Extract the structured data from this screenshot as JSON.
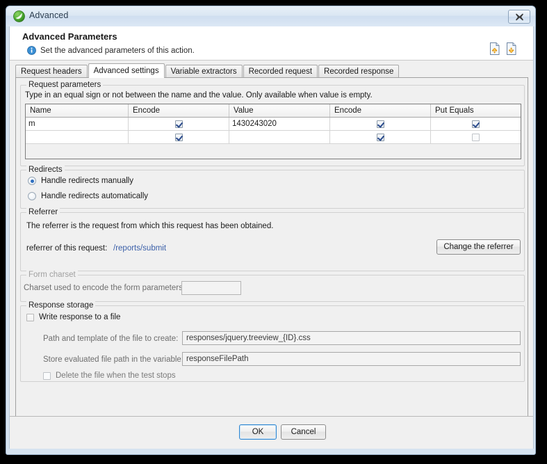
{
  "window": {
    "title": "Advanced",
    "icon": "app-green-circle-icon",
    "close_label": "Close"
  },
  "header": {
    "title": "Advanced Parameters",
    "subtitle": "Set the advanced parameters of this action.",
    "info_icon": "info-icon",
    "actions": [
      {
        "name": "import-icon",
        "tooltip": "Import"
      },
      {
        "name": "export-icon",
        "tooltip": "Export"
      }
    ]
  },
  "tabs": [
    {
      "label": "Request headers",
      "active": false
    },
    {
      "label": "Advanced settings",
      "active": true
    },
    {
      "label": "Variable extractors",
      "active": false
    },
    {
      "label": "Recorded request",
      "active": false
    },
    {
      "label": "Recorded response",
      "active": false
    }
  ],
  "request_parameters": {
    "group_title": "Request parameters",
    "hint": "Type in an equal sign or not between the name and the value. Only available when value is empty.",
    "columns": [
      "Name",
      "Encode",
      "Value",
      "Encode",
      "Put Equals"
    ],
    "rows": [
      {
        "name": "m",
        "encode1": true,
        "value": "1430243020",
        "encode2": true,
        "put_equals": true
      },
      {
        "name": "",
        "encode1": true,
        "value": "",
        "encode2": true,
        "put_equals": false
      }
    ]
  },
  "redirects": {
    "group_title": "Redirects",
    "options": [
      {
        "label": "Handle redirects manually",
        "selected": true
      },
      {
        "label": "Handle redirects automatically",
        "selected": false
      }
    ]
  },
  "referrer": {
    "group_title": "Referrer",
    "description": "The referrer is the request from which this request has been obtained.",
    "field_label": "referrer of this request:",
    "value": "/reports/submit",
    "button_label": "Change the referrer"
  },
  "form_charset": {
    "group_title": "Form charset",
    "field_label": "Charset used to encode the form parameters:",
    "value": "",
    "disabled": true
  },
  "response_storage": {
    "group_title": "Response storage",
    "write_to_file": {
      "label": "Write response to a file",
      "checked": false
    },
    "path_label": "Path and template of the file to create:",
    "path_value": "responses/jquery.treeview_{ID}.css",
    "variable_label": "Store evaluated file path in the variable:",
    "variable_value": "responseFilePath",
    "delete_on_stop": {
      "label": "Delete the file when the test stops",
      "checked": false
    }
  },
  "footer": {
    "ok_label": "OK",
    "cancel_label": "Cancel"
  },
  "colors": {
    "accent": "#2f6fc0",
    "link": "#3a5fa8",
    "frame": "#d6e3f0",
    "panel": "#f0f0f0"
  }
}
